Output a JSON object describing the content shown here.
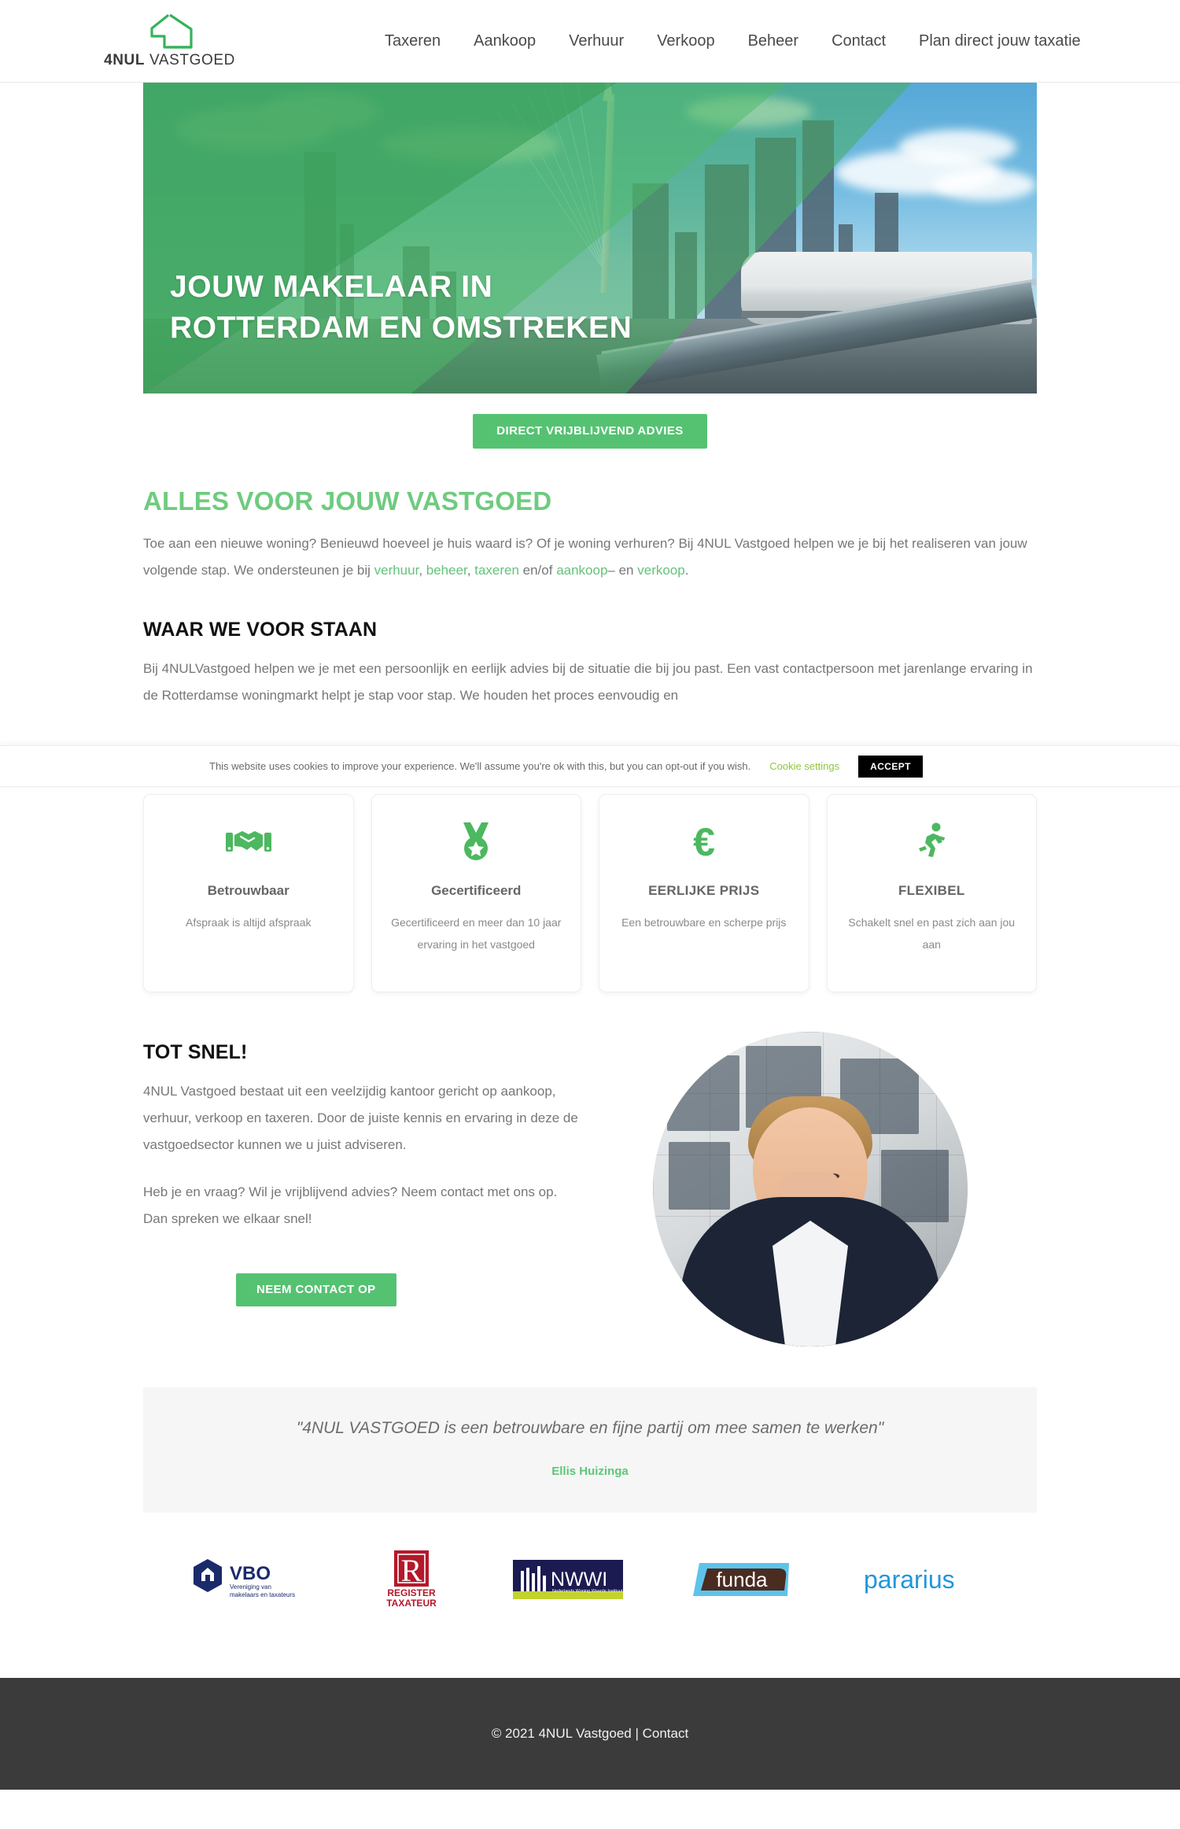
{
  "brand": {
    "name_bold": "4NUL",
    "name_rest": " VASTGOED",
    "logo_icon": "house-logo-icon"
  },
  "nav": {
    "items": [
      {
        "label": "Taxeren"
      },
      {
        "label": "Aankoop"
      },
      {
        "label": "Verhuur"
      },
      {
        "label": "Verkoop"
      },
      {
        "label": "Beheer"
      },
      {
        "label": "Contact"
      },
      {
        "label": "Plan direct jouw taxatie"
      }
    ]
  },
  "hero": {
    "title_line1": "JOUW MAKELAAR IN",
    "title_line2": "ROTTERDAM  EN OMSTREKEN",
    "overlay_color": "#45ad61"
  },
  "cta": {
    "primary_label": "DIRECT VRIJBLIJVEND ADVIES",
    "primary_color": "#55c272"
  },
  "intro": {
    "heading": "ALLES VOOR JOUW VASTGOED",
    "heading_color": "#6fcb7f",
    "paragraph_part1": "Toe aan een nieuwe woning? Benieuwd hoeveel je huis waard is? Of je woning verhuren? Bij 4NUL Vastgoed helpen we je bij het realiseren van jouw volgende stap. We ondersteunen je bij ",
    "link_verhuur": "verhuur",
    "sep1": ", ",
    "link_beheer": "beheer",
    "sep2": ", ",
    "link_taxeren": "taxeren",
    "mid": " en/of ",
    "link_aankoop": "aankoop",
    "dash": "– en ",
    "link_verkoop": "verkoop",
    "period": "."
  },
  "values": {
    "heading": "WAAR WE VOOR STAAN",
    "paragraph": "Bij 4NULVastgoed helpen we je met een persoonlijk en eerlijk advies bij de situatie die bij jou past. Een vast contactpersoon met jarenlange ervaring in de Rotterdamse woningmarkt helpt je stap voor stap. We houden het proces eenvoudig en"
  },
  "cookie": {
    "text": "This website uses cookies to improve your experience. We'll assume you're ok with this, but you can opt-out if you wish.",
    "settings_label": "Cookie settings",
    "accept_label": "ACCEPT",
    "settings_color": "#8dc63f"
  },
  "cards": [
    {
      "icon": "handshake-icon",
      "title": "Betrouwbaar",
      "desc": "Afspraak is altijd afspraak"
    },
    {
      "icon": "medal-icon",
      "title": "Gecertificeerd",
      "desc": "Gecertificeerd en meer dan 10 jaar ervaring in het vastgoed"
    },
    {
      "icon": "euro-icon",
      "title": "EERLIJKE PRIJS",
      "desc": "Een betrouwbare en scherpe prijs"
    },
    {
      "icon": "running-person-icon",
      "title": "FLEXIBEL",
      "desc": "Schakelt snel en past zich aan jou aan"
    }
  ],
  "about": {
    "heading": "TOT SNEL!",
    "paragraph1": "4NUL Vastgoed bestaat uit een veelzijdig kantoor gericht op aankoop, verhuur, verkoop en taxeren. Door de juiste kennis en ervaring in deze de vastgoedsector kunnen we u juist adviseren.",
    "paragraph2": "Heb je en vraag? Wil je vrijblijvend advies? Neem contact met ons op. Dan spreken we elkaar snel!",
    "button_label": "NEEM CONTACT OP",
    "portrait_alt": "portrait-photo"
  },
  "testimonial": {
    "quote": "\"4NUL VASTGOED is een betrouwbare en fijne partij om mee samen te werken\"",
    "author": "Ellis Huizinga",
    "author_color": "#5dc778"
  },
  "partners": [
    {
      "name": "VBO",
      "tagline_line1": "Vereniging van",
      "tagline_line2": "makelaars en taxateurs"
    },
    {
      "name": "REGISTER TAXATEUR",
      "letter": "R"
    },
    {
      "name": "NWWI",
      "tagline": "Nederlands Woning Waarde Instituut"
    },
    {
      "name": "funda"
    },
    {
      "name": "pararius"
    }
  ],
  "footer": {
    "copyright": "© 2021 4NUL Vastgoed | ",
    "contact_label": "Contact"
  }
}
